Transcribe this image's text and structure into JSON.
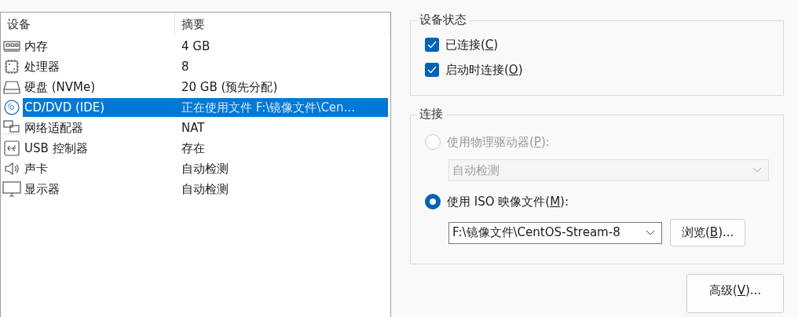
{
  "device_list": {
    "columns": [
      "设备",
      "摘要"
    ],
    "rows": [
      {
        "kind": "memory",
        "device": "内存",
        "summary": "4 GB",
        "selected": false
      },
      {
        "kind": "processor",
        "device": "处理器",
        "summary": "8",
        "selected": false
      },
      {
        "kind": "disk",
        "device": "硬盘 (NVMe)",
        "summary": "20 GB (预先分配)",
        "selected": false
      },
      {
        "kind": "cd",
        "device": "CD/DVD (IDE)",
        "summary": "正在使用文件 F:\\镜像文件\\Cen...",
        "selected": true
      },
      {
        "kind": "network",
        "device": "网络适配器",
        "summary": "NAT",
        "selected": false
      },
      {
        "kind": "usb",
        "device": "USB 控制器",
        "summary": "存在",
        "selected": false
      },
      {
        "kind": "sound",
        "device": "声卡",
        "summary": "自动检测",
        "selected": false
      },
      {
        "kind": "display",
        "device": "显示器",
        "summary": "自动检测",
        "selected": false
      }
    ]
  },
  "device_status": {
    "title": "设备状态",
    "checkboxes": [
      {
        "before": "已连接(",
        "key": "C",
        "after": ")",
        "checked": true
      },
      {
        "before": "启动时连接(",
        "key": "O",
        "after": ")",
        "checked": true
      }
    ]
  },
  "connection": {
    "title": "连接",
    "options": [
      {
        "before": "使用物理驱动器(",
        "key": "P",
        "after": "):",
        "selected": false,
        "disabled": true,
        "select_value": "自动检测"
      },
      {
        "before": "使用 ISO 映像文件(",
        "key": "M",
        "after": "):",
        "selected": true,
        "disabled": false,
        "select_value": "F:\\镜像文件\\CentOS-Stream-8",
        "button": {
          "before": "浏览(",
          "key": "B",
          "after": ")..."
        }
      }
    ]
  },
  "advanced_button": {
    "before": "高级(",
    "key": "V",
    "after": ")..."
  }
}
